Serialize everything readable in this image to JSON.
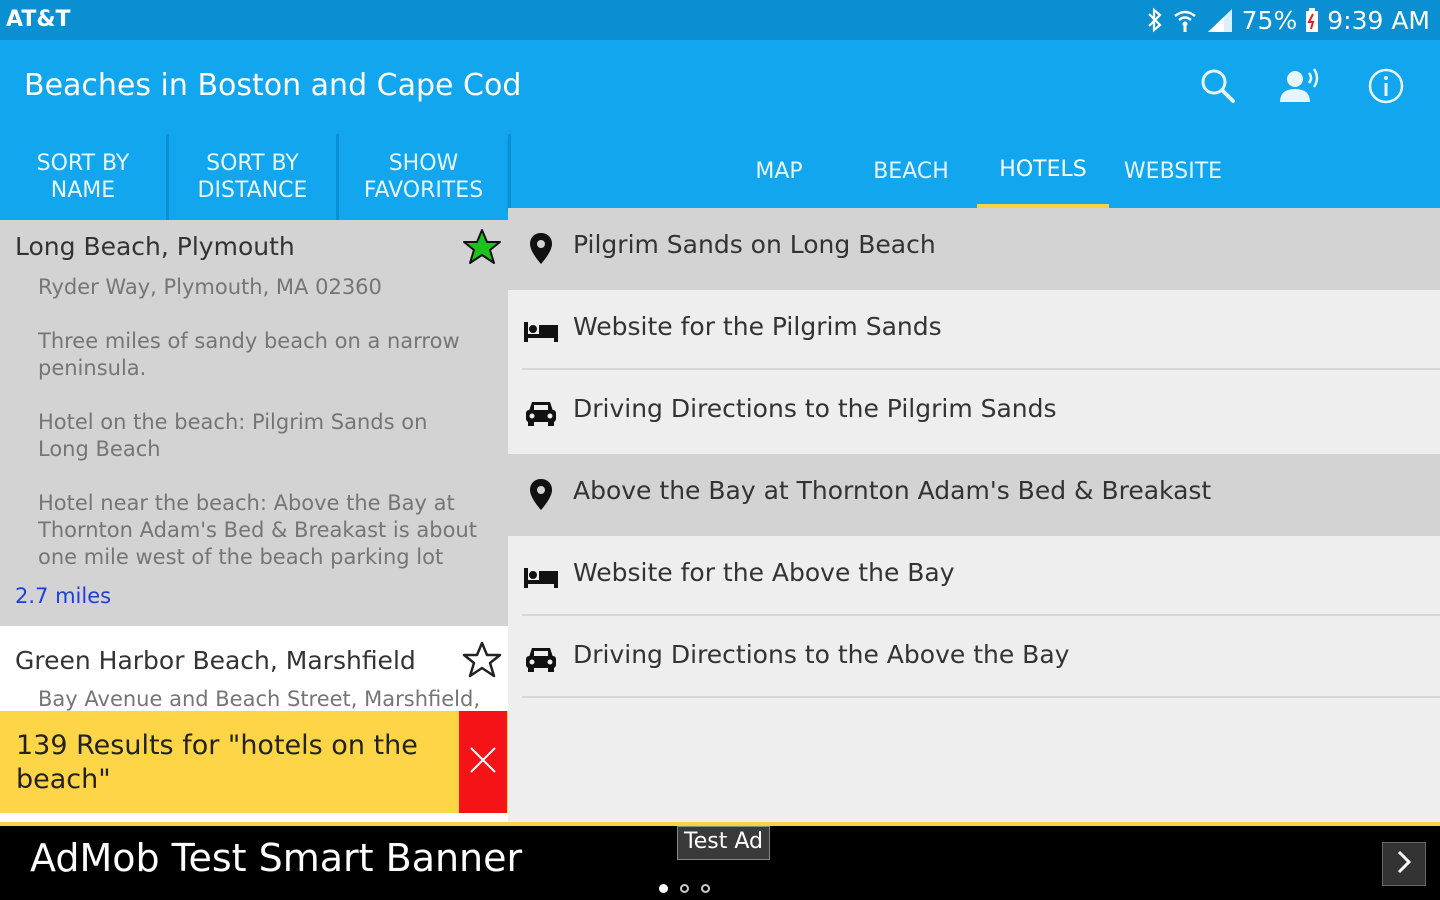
{
  "status_bar": {
    "carrier": "AT&T",
    "battery": "75%",
    "time": "9:39 AM",
    "icons": [
      "bluetooth-icon",
      "wifi-icon",
      "signal-icon",
      "battery-icon"
    ]
  },
  "app_bar": {
    "title": "Beaches in Boston and Cape Cod",
    "actions": [
      "search-icon",
      "voice-icon",
      "info-icon"
    ]
  },
  "left_tabs": [
    {
      "label": "SORT BY\nNAME"
    },
    {
      "label": "SORT BY\nDISTANCE"
    },
    {
      "label": "SHOW\nFAVORITES"
    }
  ],
  "right_tabs": [
    {
      "label": "MAP",
      "active": false
    },
    {
      "label": "BEACH",
      "active": false
    },
    {
      "label": "HOTELS",
      "active": true
    },
    {
      "label": "WEBSITE",
      "active": false
    }
  ],
  "beaches": [
    {
      "name": "Long Beach, Plymouth",
      "favorite": true,
      "address": "Ryder Way, Plymouth, MA 02360",
      "description": "Three miles of sandy beach on a narrow peninsula.",
      "hotel_on": "Hotel on the beach: Pilgrim Sands on Long Beach",
      "hotel_near": "Hotel near the beach: Above the Bay at Thornton Adam's Bed & Breakast is about one mile west of the beach parking lot",
      "distance": "2.7 miles"
    },
    {
      "name": "Green Harbor Beach, Marshfield",
      "favorite": false,
      "address": "Bay Avenue and Beach Street, Marshfield,"
    }
  ],
  "toast": {
    "text": "139 Results for \"hotels on the beach\""
  },
  "hotel_items": [
    {
      "icon": "map-pin-icon",
      "text": "Pilgrim Sands on Long Beach",
      "header": true
    },
    {
      "icon": "hotel-bed-icon",
      "text": "Website for the Pilgrim Sands",
      "header": false
    },
    {
      "icon": "car-icon",
      "text": "Driving Directions to the Pilgrim Sands",
      "header": false
    },
    {
      "icon": "map-pin-icon",
      "text": "Above the Bay at Thornton Adam's Bed & Breakast",
      "header": true
    },
    {
      "icon": "hotel-bed-icon",
      "text": "Website for the Above the Bay",
      "header": false
    },
    {
      "icon": "car-icon",
      "text": "Driving Directions to the Above the Bay",
      "header": false
    }
  ],
  "ad": {
    "text": "AdMob Test Smart Banner",
    "badge": "Test Ad"
  },
  "colors": {
    "primary": "#12a6ef",
    "primary_dark": "#0a8fd2",
    "accent": "#f7d341",
    "selected": "#d3d3d3",
    "close_red": "#f51317",
    "link_blue": "#1e3fd6",
    "favorite_green": "#1ec21e"
  }
}
